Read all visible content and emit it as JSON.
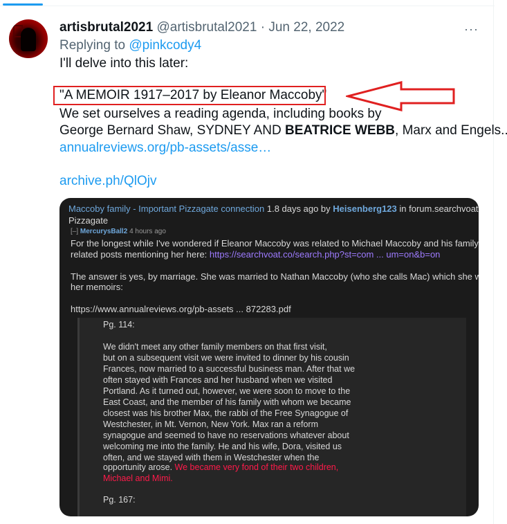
{
  "post": {
    "display_name": "artisbrutal2021",
    "handle": "@artisbrutal2021",
    "separator": " · ",
    "date": "Jun 22, 2022",
    "more_label": "···",
    "replying_prefix": "Replying to ",
    "replying_handle": "@pinkcody4",
    "line1": "I'll delve into this later:",
    "line2": "\"A MEMOIR 1917–2017 by Eleanor Maccoby\"",
    "line3": "We set ourselves a reading agenda, including books by",
    "line4_a": "George Bernard Shaw, SYDNEY AND ",
    "line4_b": "BEATRICE WEBB",
    "line4_c": ", Marx and Engels..\"",
    "link1": "annualreviews.org/pb-assets/asse…",
    "link2": "archive.ph/QlOjv"
  },
  "embed": {
    "title": "Maccoby family - Important Pizzagate connection",
    "meta_mid": " 1.8 days ago by ",
    "meta_user": "Heisenberg123",
    "meta_end": " in forum.searchvoat.co",
    "category": "Pizzagate",
    "comment_toggle": "[–]",
    "comment_user": "MercurysBall2",
    "comment_time": "4 hours ago",
    "p1_line1": "For the longest while I've wondered if Eleanor Maccoby was related to Michael Maccoby and his family. See our",
    "p1_line2_a": "related posts mentioning her here: ",
    "p1_line2_link": "https://searchvoat.co/search.php?st=com ... um=on&b=on",
    "p2_line1": "The answer is yes, by marriage. She was married to Nathan Maccoby (who she calls Mac) which she writes about in",
    "p2_line2": "her memoirs:",
    "p3_link": "https://www.annualreviews.org/pb-assets ... 872283.pdf",
    "quote_lines": [
      "Pg. 114:",
      "",
      "We didn't meet any other family members on that first visit,",
      "but on a subsequent visit we were invited to dinner by his cousin",
      "Frances, now married to a successful business man. After that we",
      "often stayed with Frances and her husband when we visited",
      "Portland. As it turned out, however, we were soon to move to the",
      "East Coast, and the member of his family with whom we became",
      "closest was his brother Max, the rabbi of the Free Synagogue of",
      "Westchester, in Mt. Vernon, New York. Max ran a reform",
      "synagogue and seemed to have no reservations whatever about",
      "welcoming me into the family. He and his wife, Dora, visited us",
      "often, and we stayed with them in Westchester when the"
    ],
    "quote_line13_a": "opportunity arose. ",
    "quote_line13_red": "We became very fond of their two children,",
    "quote_line14_red": "Michael and Mimi.",
    "quote_pg2": "Pg. 167:"
  },
  "colors": {
    "link": "#1d9bf0",
    "highlight_box": "#e02020",
    "embed_bg": "#1b1b1b",
    "quote_red": "#ff1a4a"
  }
}
